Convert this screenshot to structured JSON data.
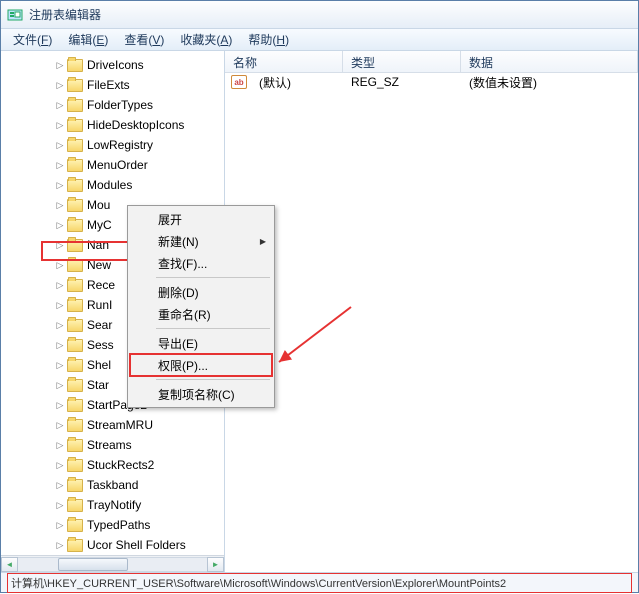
{
  "window": {
    "title": "注册表编辑器"
  },
  "menubar": [
    {
      "label": "文件",
      "accel": "F"
    },
    {
      "label": "编辑",
      "accel": "E"
    },
    {
      "label": "查看",
      "accel": "V"
    },
    {
      "label": "收藏夹",
      "accel": "A"
    },
    {
      "label": "帮助",
      "accel": "H"
    }
  ],
  "tree_items": [
    "DriveIcons",
    "FileExts",
    "FolderTypes",
    "HideDesktopIcons",
    "LowRegistry",
    "MenuOrder",
    "Modules",
    "MountPoints2",
    "MyC",
    "Nan",
    "New",
    "Rece",
    "RunI",
    "Sear",
    "Sess",
    "Shel",
    "Star",
    "StartPage",
    "StreamMRU",
    "Streams",
    "StuckRects2",
    "Taskband",
    "TrayNotify",
    "TypedPaths",
    "User Shell Folders"
  ],
  "tree_truncated_display": {
    "7": "Mou",
    "16": "Star",
    "17": "StartPage2",
    "24": "Ucor Shell Folders"
  },
  "list": {
    "columns": {
      "name": "名称",
      "type": "类型",
      "data": "数据"
    },
    "rows": [
      {
        "name": "(默认)",
        "type": "REG_SZ",
        "data": "(数值未设置)"
      }
    ]
  },
  "context_menu": [
    {
      "label": "展开",
      "type": "item"
    },
    {
      "label": "新建(N)",
      "type": "sub"
    },
    {
      "label": "查找(F)...",
      "type": "item"
    },
    {
      "type": "sep"
    },
    {
      "label": "删除(D)",
      "type": "item"
    },
    {
      "label": "重命名(R)",
      "type": "item"
    },
    {
      "type": "sep"
    },
    {
      "label": "导出(E)",
      "type": "item"
    },
    {
      "label": "权限(P)...",
      "type": "item",
      "highlight": true
    },
    {
      "type": "sep"
    },
    {
      "label": "复制项名称(C)",
      "type": "item"
    }
  ],
  "statusbar": {
    "path": "计算机\\HKEY_CURRENT_USER\\Software\\Microsoft\\Windows\\CurrentVersion\\Explorer\\MountPoints2"
  }
}
